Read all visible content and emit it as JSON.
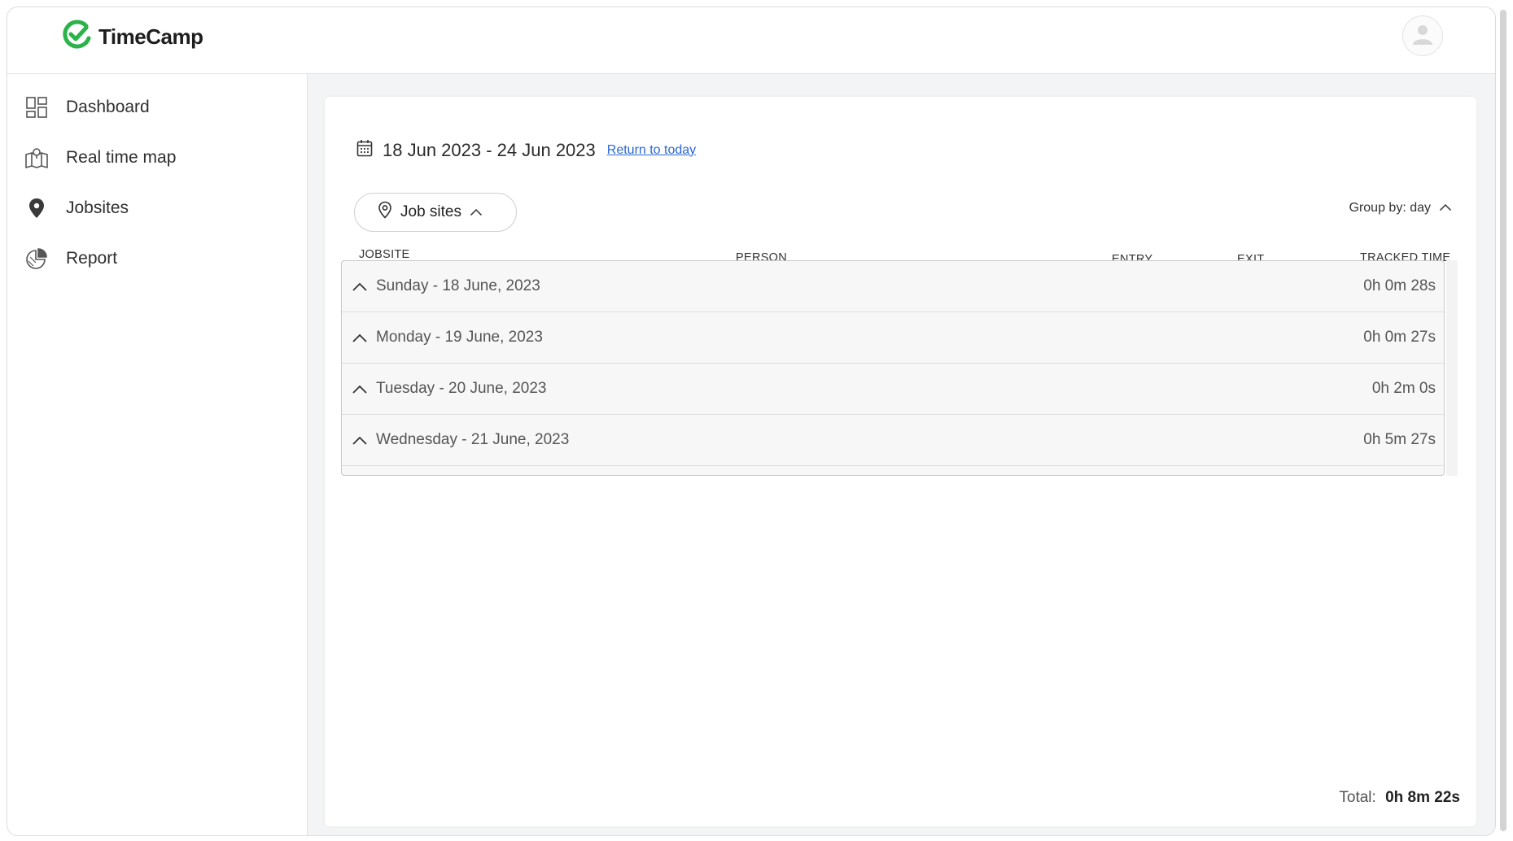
{
  "app": {
    "logo_text": "TimeCamp",
    "brand_color": "#2bb34a"
  },
  "header": {
    "avatar_icon": "user-avatar-icon"
  },
  "sidebar": {
    "items": [
      {
        "label": "Dashboard",
        "icon": "dashboard-grid-icon"
      },
      {
        "label": "Real time map",
        "icon": "map-icon"
      },
      {
        "label": "Jobsites",
        "icon": "location-pin-icon"
      },
      {
        "label": "Report",
        "icon": "pie-chart-icon"
      }
    ]
  },
  "main": {
    "date_range": "18 Jun 2023 - 24 Jun 2023",
    "return_link": "Return to today",
    "jobsites_filter": "Job sites",
    "group_by": "Group by: day",
    "columns": {
      "jobsite": "JOBSITE",
      "person": "PERSON",
      "entry": "ENTRY",
      "exit": "EXIT",
      "tracked_time": "TRACKED TIME"
    },
    "rows": [
      {
        "label": "Sunday - 18 June, 2023",
        "time": "0h 0m 28s"
      },
      {
        "label": "Monday - 19 June, 2023",
        "time": "0h 0m 27s"
      },
      {
        "label": "Tuesday - 20 June, 2023",
        "time": "0h 2m 0s"
      },
      {
        "label": "Wednesday - 21 June, 2023",
        "time": "0h 5m 27s"
      }
    ],
    "total_label": "Total:",
    "total_value": "0h 8m 22s"
  }
}
